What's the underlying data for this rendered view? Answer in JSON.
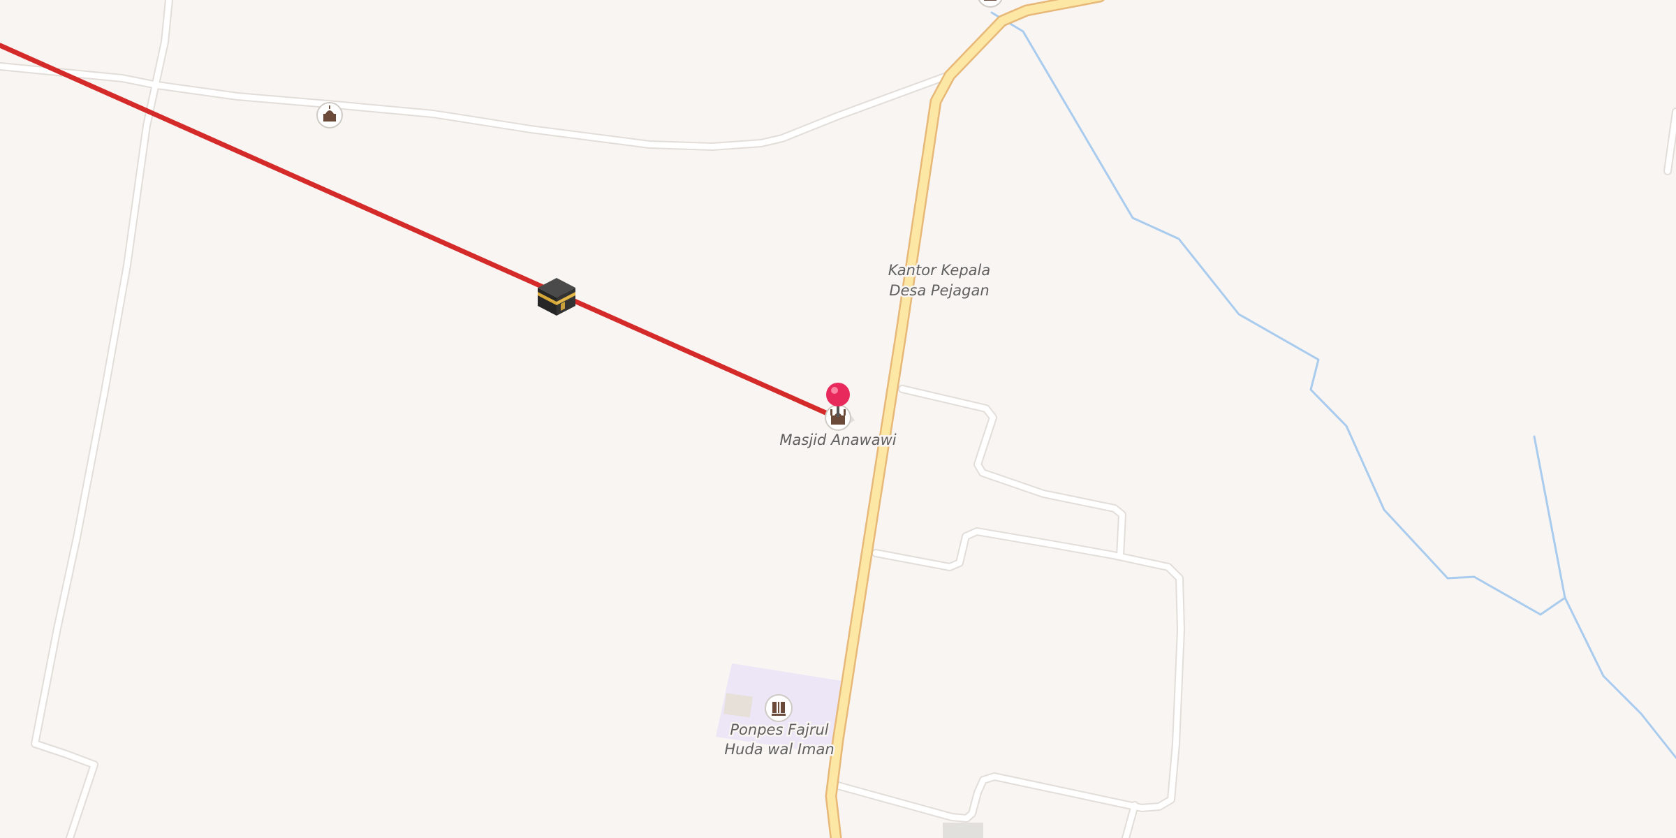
{
  "map": {
    "background_color": "#f8f5f2",
    "labels": {
      "kantor_line1": "Kantor Kepala",
      "kantor_line2": "Desa Pejagan",
      "masjid": "Masjid Anawawi",
      "ponpes_line1": "Ponpes Fajrul",
      "ponpes_line2": "Huda wal Iman"
    },
    "colors": {
      "minor_road": "#ffffff",
      "road_casing": "#e2ddd8",
      "main_road_fill": "#fde7a5",
      "main_road_casing": "#e7b877",
      "waterway": "#a9cbee",
      "qibla_line": "#d42a2a",
      "pin": "#e8295c",
      "school_area": "#ece6f6"
    },
    "icons": {
      "kaaba": "kaaba-icon",
      "location_pin": "location-pin-icon",
      "mosque": "mosque-icon",
      "school": "school-icon"
    }
  }
}
